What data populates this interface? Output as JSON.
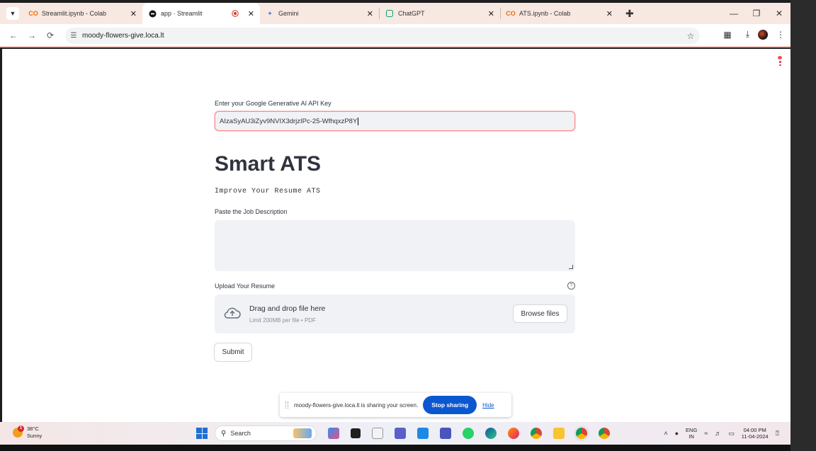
{
  "browser": {
    "tabs": [
      {
        "title": "Streamlit.ipynb - Colab",
        "favicon": "colab-icon",
        "active": false
      },
      {
        "title": "app · Streamlit",
        "favicon": "streamlit-icon",
        "active": true
      },
      {
        "title": "Gemini",
        "favicon": "gemini-icon",
        "active": false
      },
      {
        "title": "ChatGPT",
        "favicon": "chatgpt-icon",
        "active": false
      },
      {
        "title": "ATS.ipynb - Colab",
        "favicon": "colab-icon",
        "active": false
      }
    ],
    "url": "moody-flowers-give.loca.lt"
  },
  "app": {
    "api_key_label": "Enter your Google Generative AI API Key",
    "api_key_value": "AIzaSyAU3iZyv9NVIX3drjzIPc-25-WfhqxzP8Y",
    "title": "Smart ATS",
    "subtitle": "Improve Your Resume ATS",
    "job_desc_label": "Paste the Job Description",
    "job_desc_value": "",
    "upload_label": "Upload Your Resume",
    "dropzone_main": "Drag and drop file here",
    "dropzone_limit": "Limit 200MB per file • PDF",
    "browse_label": "Browse files",
    "submit_label": "Submit"
  },
  "share_bar": {
    "message": "moody-flowers-give.loca.lt is sharing your screen.",
    "stop_label": "Stop sharing",
    "hide_label": "Hide"
  },
  "taskbar": {
    "weather_badge": "1",
    "temperature": "38°C",
    "condition": "Sunny",
    "search_placeholder": "Search",
    "lang_1": "ENG",
    "lang_2": "IN",
    "time": "04:00 PM",
    "date": "11-04-2024"
  },
  "colors": {
    "accent": "#ff4b4b",
    "input_bg": "#f0f2f6",
    "share_button": "#0b57d0",
    "tabbar_bg": "#f7e8e1"
  }
}
